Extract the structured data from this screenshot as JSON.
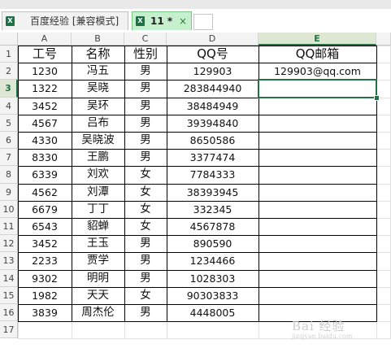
{
  "tabs": [
    {
      "label": "百度经验  [兼容模式]",
      "active": false
    },
    {
      "label": "11 *",
      "active": true
    }
  ],
  "tab_close_glyph": "×",
  "file_icon_glyph": "X",
  "columns": [
    "A",
    "B",
    "C",
    "D",
    "E"
  ],
  "selected_column": "E",
  "selected_row": 3,
  "headers": [
    "工号",
    "名称",
    "性别",
    "QQ号",
    "QQ邮箱"
  ],
  "rows": [
    {
      "num": "2",
      "id": "1230",
      "name": "冯五",
      "gender": "男",
      "qq": "129903",
      "email": "129903@qq.com"
    },
    {
      "num": "3",
      "id": "1322",
      "name": "吴晓",
      "gender": "男",
      "qq": "283844940",
      "email": ""
    },
    {
      "num": "4",
      "id": "3452",
      "name": "吴环",
      "gender": "男",
      "qq": "38484949",
      "email": ""
    },
    {
      "num": "5",
      "id": "4567",
      "name": "吕布",
      "gender": "男",
      "qq": "39394840",
      "email": ""
    },
    {
      "num": "6",
      "id": "4330",
      "name": "吴晓波",
      "gender": "男",
      "qq": "8650586",
      "email": ""
    },
    {
      "num": "7",
      "id": "8330",
      "name": "王鹏",
      "gender": "男",
      "qq": "3377474",
      "email": ""
    },
    {
      "num": "8",
      "id": "6339",
      "name": "刘欢",
      "gender": "女",
      "qq": "7784333",
      "email": ""
    },
    {
      "num": "9",
      "id": "4562",
      "name": "刘潭",
      "gender": "女",
      "qq": "38393945",
      "email": ""
    },
    {
      "num": "10",
      "id": "6679",
      "name": "丁丁",
      "gender": "女",
      "qq": "332345",
      "email": ""
    },
    {
      "num": "11",
      "id": "6543",
      "name": "貂蝉",
      "gender": "女",
      "qq": "4567878",
      "email": ""
    },
    {
      "num": "12",
      "id": "3452",
      "name": "王玉",
      "gender": "男",
      "qq": "890590",
      "email": ""
    },
    {
      "num": "13",
      "id": "2233",
      "name": "贾学",
      "gender": "男",
      "qq": "1234466",
      "email": ""
    },
    {
      "num": "14",
      "id": "9302",
      "name": "明明",
      "gender": "男",
      "qq": "1028303",
      "email": ""
    },
    {
      "num": "15",
      "id": "1982",
      "name": "天天",
      "gender": "女",
      "qq": "90303833",
      "email": ""
    },
    {
      "num": "16",
      "id": "3839",
      "name": "周杰伦",
      "gender": "男",
      "qq": "4448005",
      "email": ""
    }
  ],
  "empty_row_num": "17",
  "header_row_num": "1",
  "watermark": "Bai 经验",
  "watermark_sub": "jingyan.baidu.com",
  "colors": {
    "accent": "#217346",
    "active_tab": "#c6efce"
  }
}
